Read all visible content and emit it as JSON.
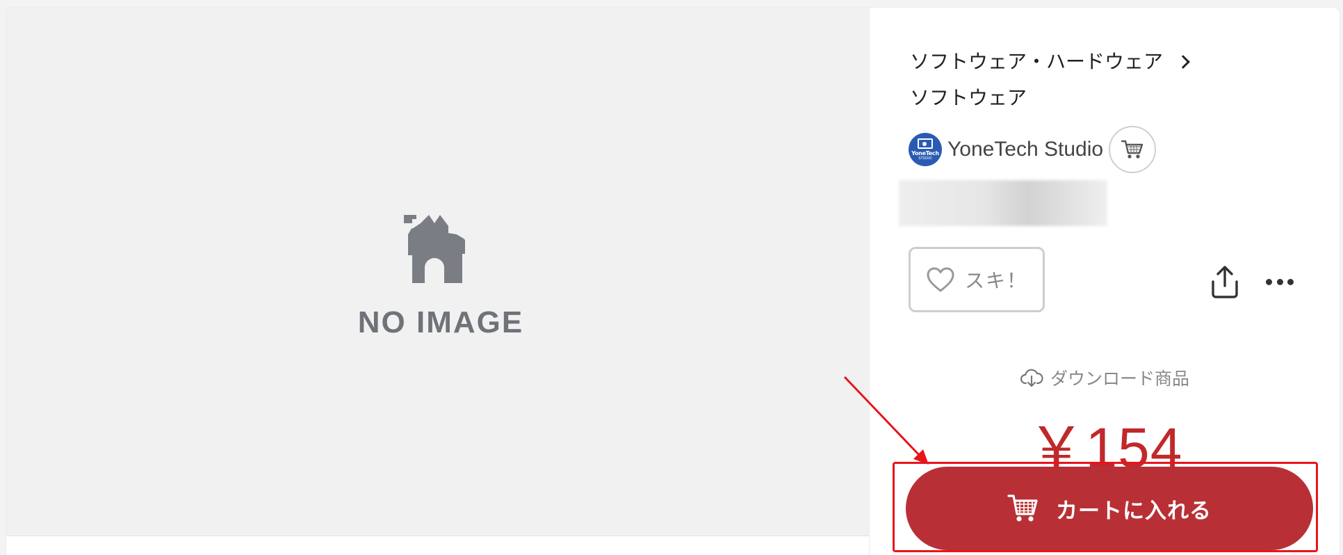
{
  "image_pane": {
    "placeholder_text": "NO IMAGE"
  },
  "breadcrumb": {
    "category": "ソフトウェア・ハードウェア",
    "subcategory": "ソフトウェア"
  },
  "shop": {
    "avatar_text": "YoneTech",
    "avatar_subtext": "STUDIO",
    "name": "YoneTech Studio",
    "cart_icon": "shop-cart-icon"
  },
  "actions": {
    "like_label": "スキ！",
    "like_icon": "heart-icon",
    "share_icon": "share-icon",
    "more_icon": "more-icon"
  },
  "product": {
    "type_label": "ダウンロード商品",
    "type_icon": "cloud-download-icon",
    "price": "￥154"
  },
  "cart_button": {
    "label": "カートに入れる",
    "icon": "cart-icon"
  },
  "colors": {
    "accent": "#b83035",
    "price": "#c0292b",
    "annotation": "#e8141b",
    "avatar": "#2a5bb3"
  }
}
